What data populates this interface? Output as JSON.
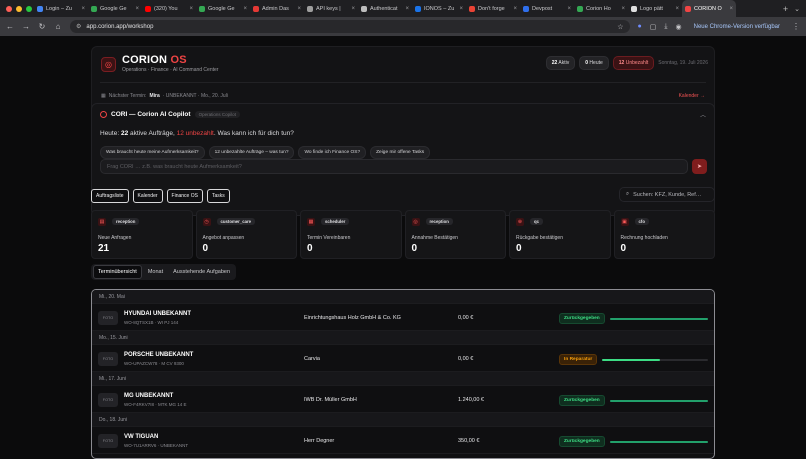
{
  "browser": {
    "tabs": [
      {
        "label": "Login – Zu",
        "color": "#4285f4"
      },
      {
        "label": "Google Ge",
        "color": "#34a853"
      },
      {
        "label": "(320) You",
        "color": "#ff0000"
      },
      {
        "label": "Google Ge",
        "color": "#34a853"
      },
      {
        "label": "Admin Das",
        "color": "#e53935"
      },
      {
        "label": "API keys |",
        "color": "#9e9e9e"
      },
      {
        "label": "Authenticat",
        "color": "#bdbdbd"
      },
      {
        "label": "IONOS – Zu",
        "color": "#1a73e8"
      },
      {
        "label": "Don't forge",
        "color": "#ea4335"
      },
      {
        "label": "Devpost",
        "color": "#2f6fed"
      },
      {
        "label": "Corion Ho",
        "color": "#34a853"
      },
      {
        "label": "Logo pätt",
        "color": "#e0e0e0"
      },
      {
        "label": "CORION O",
        "color": "#ef4444"
      }
    ],
    "url": "app.corion.app/workshop",
    "update_label": "Neue Chrome-Version verfügbar"
  },
  "header": {
    "brand": "CORION",
    "brand_suffix": "OS",
    "tagline": "Operations · Finance · AI Command Center",
    "badges": [
      {
        "count": "22",
        "label": "Aktiv"
      },
      {
        "count": "0",
        "label": "Heute"
      },
      {
        "count": "12",
        "label": "Unbezahlt"
      }
    ],
    "date": "Sonntag, 19. Juli 2026",
    "next_label": "Nächster Termin:",
    "next_name": "Mira",
    "next_rest": "· UNBEKANNT · Mo., 20. Juli",
    "calendar_link": "Kalender →"
  },
  "copilot": {
    "title": "CORI — Corion AI Copilot",
    "tag": "Operations Copilot",
    "msg_prefix": "Heute:",
    "msg_active": "22",
    "msg_mid": "aktive Aufträge,",
    "msg_unpaid": "12 unbezahlt",
    "msg_suffix": ". Was kann ich für dich tun?",
    "chips": [
      "Was braucht heute meine Aufmerksamkeit?",
      "12 unbezahlte Aufträge – was tun?",
      "Wo finde ich Finance OS?",
      "Zeige mir offene Tasks"
    ],
    "placeholder": "Frag CORI … z.B. was braucht heute Aufmerksamkeit?"
  },
  "actions": [
    "Auftragsliste",
    "Kalender",
    "Finance OS",
    "Tasks"
  ],
  "search_placeholder": "Suchen: KFZ, Kunde, Ref…",
  "stats": [
    {
      "tag": "reception",
      "label": "Neue Anfragen",
      "value": "21"
    },
    {
      "tag": "customer_care",
      "label": "Angebot anpassen",
      "value": "0"
    },
    {
      "tag": "scheduler",
      "label": "Termin Vereinbaren",
      "value": "0"
    },
    {
      "tag": "reception",
      "label": "Annahme Bestätigen",
      "value": "0"
    },
    {
      "tag": "qc",
      "label": "Rückgabe bestätigen",
      "value": "0"
    },
    {
      "tag": "cfo",
      "label": "Rechnung hochladen",
      "value": "0"
    }
  ],
  "view_tabs": [
    "Terminübersicht",
    "Monat",
    "Ausstehende Aufgaben"
  ],
  "table": {
    "foto_label": "FOTO",
    "groups": [
      {
        "day": "Mi., 20. Mai",
        "car": "HYUNDAI UNBEKANNT",
        "plate": "WO-8QTSX1B · WI PJ 144",
        "customer": "Einrichtungshaus Holz GmbH & Co. KG",
        "price": "0,00 €",
        "status": "Zurückgegeben",
        "progress": 1.0
      },
      {
        "day": "Mo., 15. Juni",
        "car": "PORSCHE UNBEKANNT",
        "plate": "WO-UPAZCW78 · M CV 9300",
        "customer": "Carvia",
        "price": "0,00 €",
        "status": "In Reparatur",
        "progress": 0.55
      },
      {
        "day": "Mi., 17. Juni",
        "car": "MG UNBEKANNT",
        "plate": "WO-F4RKV7I8 · MTK MG 14 E",
        "customer": "IWB Dr. Müller GmbH",
        "price": "1.240,00 €",
        "status": "Zurückgegeben",
        "progress": 1.0
      },
      {
        "day": "Do., 18. Juni",
        "car": "VW TIGUAN",
        "plate": "WO-7U1ARRV6 · UNBEKANNT",
        "customer": "Herr Degner",
        "price": "350,00 €",
        "status": "Zurückgegeben",
        "progress": 1.0
      }
    ]
  },
  "colors": {
    "accent": "#ef4444",
    "done": "#3ddc84",
    "repair": "#f59e0b",
    "bar_done": "#22a06b"
  }
}
